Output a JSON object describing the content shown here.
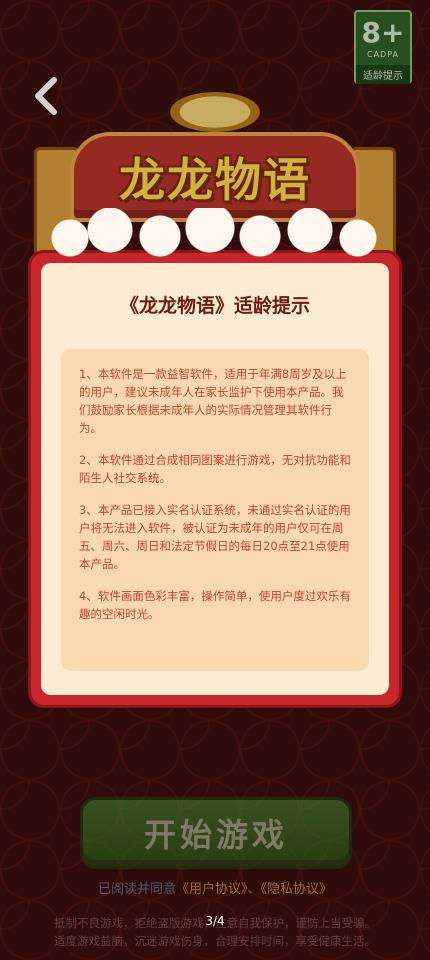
{
  "age_rating": {
    "number": "8+",
    "org": "CADPA",
    "label": "适龄提示"
  },
  "banner": {
    "game_name": "龙龙物语"
  },
  "dialog": {
    "title": "《龙龙物语》适龄提示",
    "items": [
      "1、本软件是一款益智软件，适用于年满8周岁及以上的用户，建议未成年人在家长监护下使用本产品。我们鼓励家长根据未成年人的实际情况管理其软件行为。",
      "2、本软件通过合成相同图案进行游戏，无对抗功能和陌生人社交系统。",
      "3、本产品已接入实名认证系统，未通过实名认证的用户将无法进入软件，被认证为未成年的用户仅可在周五、周六、周日和法定节假日的每日20点至21点使用本产品。",
      "4、软件画面色彩丰富，操作简单，使用户度过欢乐有趣的空闲时光。"
    ]
  },
  "start_button": {
    "label": "开始游戏"
  },
  "agreement": {
    "prefix": "已阅读并同意",
    "user_agreement": "《用户协议》",
    "separator": "、",
    "privacy_policy": "《隐私协议》"
  },
  "footer": {
    "line1": "抵制不良游戏，拒绝盗版游戏，注意自我保护，谨防上当受骗。",
    "line2": "适度游戏益脑，沉迷游戏伤身，合理安排时间，享受健康生活。"
  },
  "page_indicator": "3/4",
  "colors": {
    "background": "#3a0f0c",
    "dialog_frame": "#c8262a",
    "dialog_paper": "#fdebd3",
    "notice_text": "#c4432e",
    "start_button": "#2d7a24",
    "link": "#e6a234"
  }
}
